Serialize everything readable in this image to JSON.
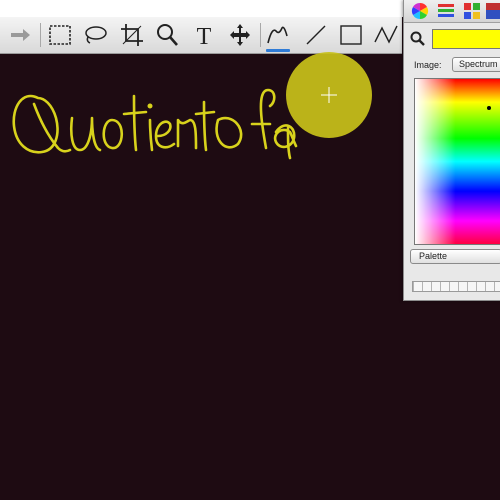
{
  "toolbar": {
    "tools": [
      {
        "name": "forward-arrow-tool",
        "icon": "arrow-icon"
      },
      {
        "name": "rectangle-select-tool",
        "icon": "marquee-icon"
      },
      {
        "name": "lasso-tool",
        "icon": "lasso-icon"
      },
      {
        "name": "crop-tool",
        "icon": "crop-icon"
      },
      {
        "name": "zoom-tool",
        "icon": "magnifier-icon"
      },
      {
        "name": "text-tool",
        "icon": "text-icon",
        "label": "T"
      },
      {
        "name": "move-tool",
        "icon": "move-icon"
      },
      {
        "name": "pen-tool",
        "icon": "pen-icon",
        "selected": true
      },
      {
        "name": "line-tool",
        "icon": "line-icon"
      },
      {
        "name": "rectangle-tool",
        "icon": "rectangle-icon"
      },
      {
        "name": "polyline-tool",
        "icon": "polyline-icon"
      }
    ]
  },
  "canvas": {
    "handwritten_text": "Quotient of ap",
    "ink_color": "#d8d21c",
    "background": "#1e0b12"
  },
  "color_panel": {
    "current_color": "#ffff00",
    "image_label": "Image:",
    "image_mode": "Spectrum",
    "palette_label": "Palette"
  }
}
